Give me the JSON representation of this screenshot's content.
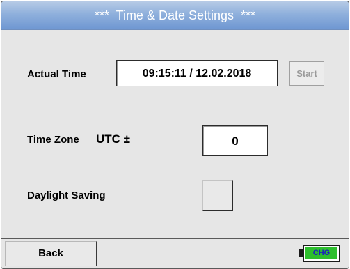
{
  "header": {
    "title": "***  Time & Date Settings  ***"
  },
  "actual_time": {
    "label": "Actual Time",
    "value": "09:15:11 / 12.02.2018",
    "start_label": "Start"
  },
  "time_zone": {
    "label": "Time Zone",
    "utc_label": "UTC ±",
    "value": "0"
  },
  "daylight_saving": {
    "label": "Daylight Saving",
    "checked": false
  },
  "footer": {
    "back_label": "Back",
    "battery_status": "CHG"
  },
  "colors": {
    "titlebar": "#8fb0dc",
    "background": "#e6e6e6",
    "battery_fill": "#2dbf2d",
    "battery_text": "#1b1fbf",
    "disabled_text": "#9a9a9a"
  },
  "icons": {
    "battery": "battery-charging-icon"
  }
}
